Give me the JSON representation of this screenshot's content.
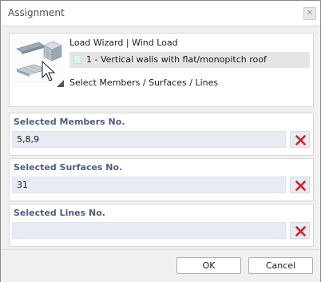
{
  "window": {
    "title": "Assignment",
    "close_icon": "close-icon"
  },
  "load_wizard": {
    "title": "Load Wizard | Wind Load",
    "selected_value": "1 - Vertical walls with flat/monopitch roof",
    "swatch_color": "#d8f3f3",
    "subtitle": "Select Members / Surfaces / Lines",
    "icon": "wind-load-wizard-icon"
  },
  "sections": [
    {
      "label": "Selected Members No.",
      "value": "5,8,9"
    },
    {
      "label": "Selected Surfaces No.",
      "value": "31"
    },
    {
      "label": "Selected Lines No.",
      "value": ""
    }
  ],
  "colors": {
    "section_label": "#4f5e86",
    "input_bg": "#e7ebf4",
    "delete_red": "#d62020"
  },
  "footer": {
    "ok_label": "OK",
    "cancel_label": "Cancel"
  }
}
